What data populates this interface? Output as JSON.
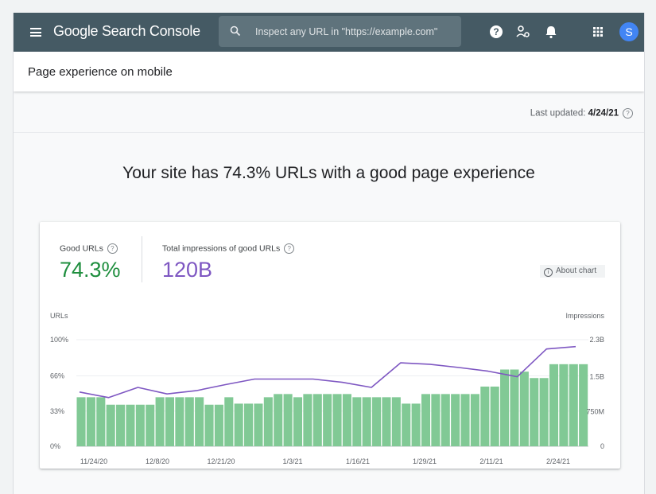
{
  "app": {
    "brand": "Google Search Console",
    "search_placeholder": "Inspect any URL in \"https://example.com\"",
    "avatar_letter": "S"
  },
  "page": {
    "title": "Page experience on mobile",
    "last_updated_label": "Last updated:",
    "last_updated_value": "4/24/21",
    "headline": "Your site has 74.3% URLs with a good page experience"
  },
  "card": {
    "good_urls_label": "Good URLs",
    "good_urls_value": "74.3%",
    "impressions_label": "Total impressions of good URLs",
    "impressions_value": "120B",
    "about_chart": "About chart"
  },
  "colors": {
    "good": "#1e8e3e",
    "bar": "#81c995",
    "impressions": "#7e57c2",
    "appbar": "#455a64"
  },
  "chart_data": {
    "type": "bar",
    "left_axis_title": "URLs",
    "right_axis_title": "Impressions",
    "left_ticks": [
      "100%",
      "66%",
      "33%",
      "0%"
    ],
    "left_tick_values": [
      100,
      66,
      33,
      0
    ],
    "right_ticks": [
      "2.3B",
      "1.5B",
      "750M",
      "0"
    ],
    "right_tick_values": [
      2.3,
      1.5,
      0.75,
      0
    ],
    "x_labels": [
      "11/24/20",
      "12/8/20",
      "12/21/20",
      "1/3/21",
      "1/16/21",
      "1/29/21",
      "2/11/21",
      "2/24/21"
    ],
    "ylim": [
      0,
      100
    ],
    "y2lim": [
      0,
      2.3
    ],
    "series": [
      {
        "axis": "left",
        "kind": "bar",
        "values": [
          46,
          46,
          46,
          39,
          39,
          39,
          39,
          39,
          46,
          46,
          46,
          46,
          46,
          39,
          39,
          46,
          40,
          40,
          40,
          46,
          49,
          49,
          46,
          49,
          49,
          49,
          49,
          49,
          46,
          46,
          46,
          46,
          46,
          40,
          40,
          49,
          49,
          49,
          49,
          49,
          49,
          56,
          56,
          72,
          72,
          70,
          64,
          64,
          77,
          77,
          77,
          77
        ]
      },
      {
        "axis": "right",
        "kind": "line",
        "values": [
          1.17,
          1.05,
          1.27,
          1.13,
          1.2,
          1.33,
          1.45,
          1.45,
          1.45,
          1.38,
          1.27,
          1.8,
          1.77,
          1.7,
          1.62,
          1.5,
          2.1,
          2.15
        ]
      }
    ]
  }
}
